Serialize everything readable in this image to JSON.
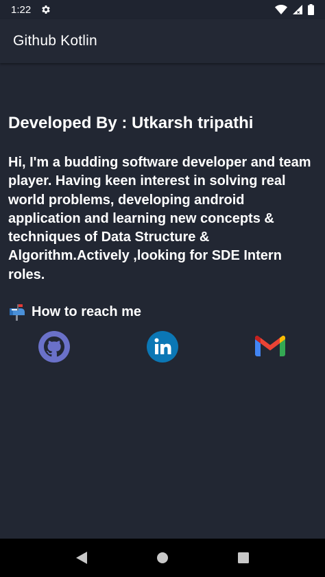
{
  "status_bar": {
    "time": "1:22",
    "icons": [
      "settings-gear-icon",
      "wifi-icon",
      "signal-icon",
      "battery-icon"
    ]
  },
  "app_bar": {
    "title": "Github Kotlin"
  },
  "about": {
    "developer_title": "Developed By : Utkarsh tripathi",
    "bio": "Hi, I'm a budding software developer and team player. Having keen interest in solving real world problems, developing android application and learning new concepts & techniques of Data Structure & Algorithm.Actively ,looking for SDE Intern roles.",
    "reach_heading": "How to reach me",
    "reach_icon": "mailbox-icon"
  },
  "social_links": [
    {
      "name": "github",
      "icon": "github-icon"
    },
    {
      "name": "linkedin",
      "icon": "linkedin-icon"
    },
    {
      "name": "gmail",
      "icon": "gmail-icon"
    }
  ],
  "nav_bar": {
    "buttons": [
      "back-icon",
      "home-icon",
      "recents-icon"
    ]
  },
  "colors": {
    "background": "#222733",
    "app_bar": "#232834",
    "text": "#ffffff",
    "github": "#6a71c9",
    "linkedin": "#0b77b5",
    "nav_bar": "#000000"
  }
}
